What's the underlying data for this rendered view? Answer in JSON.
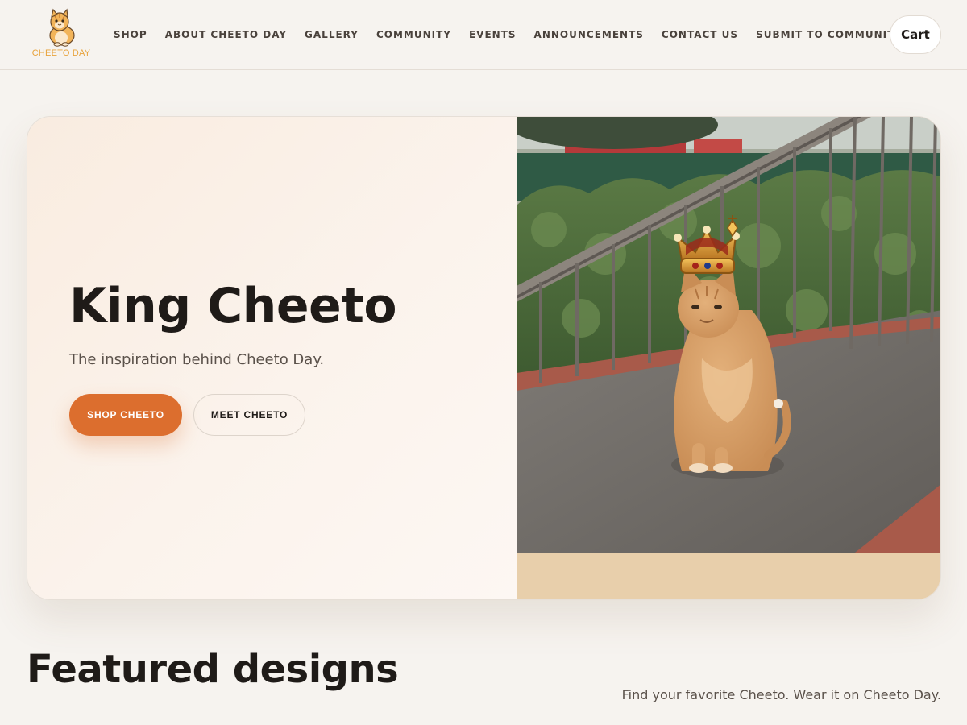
{
  "header": {
    "logo_text": "CHEETO DAY",
    "nav": [
      {
        "label": "SHOP"
      },
      {
        "label": "ABOUT CHEETO DAY"
      },
      {
        "label": "GALLERY"
      },
      {
        "label": "COMMUNITY"
      },
      {
        "label": "EVENTS"
      },
      {
        "label": "ANNOUNCEMENTS"
      },
      {
        "label": "CONTACT US"
      },
      {
        "label": "SUBMIT TO COMMUNITY"
      }
    ],
    "cart_label": "Cart"
  },
  "hero": {
    "title": "King Cheeto",
    "subtitle": "The inspiration behind Cheeto Day.",
    "primary_button": "SHOP CHEETO",
    "secondary_button": "MEET CHEETO",
    "image_icon": "crowned-orange-cat-photo"
  },
  "featured": {
    "title": "Featured designs",
    "subtitle": "Find your favorite Cheeto. Wear it on Cheeto Day."
  },
  "colors": {
    "page_background": "#f6f3ef",
    "accent": "#dc6e2e",
    "text": "#1f1b18",
    "muted_text": "#5a514a",
    "photo_band": "#e8cfab",
    "logo": "#e8a33c"
  }
}
